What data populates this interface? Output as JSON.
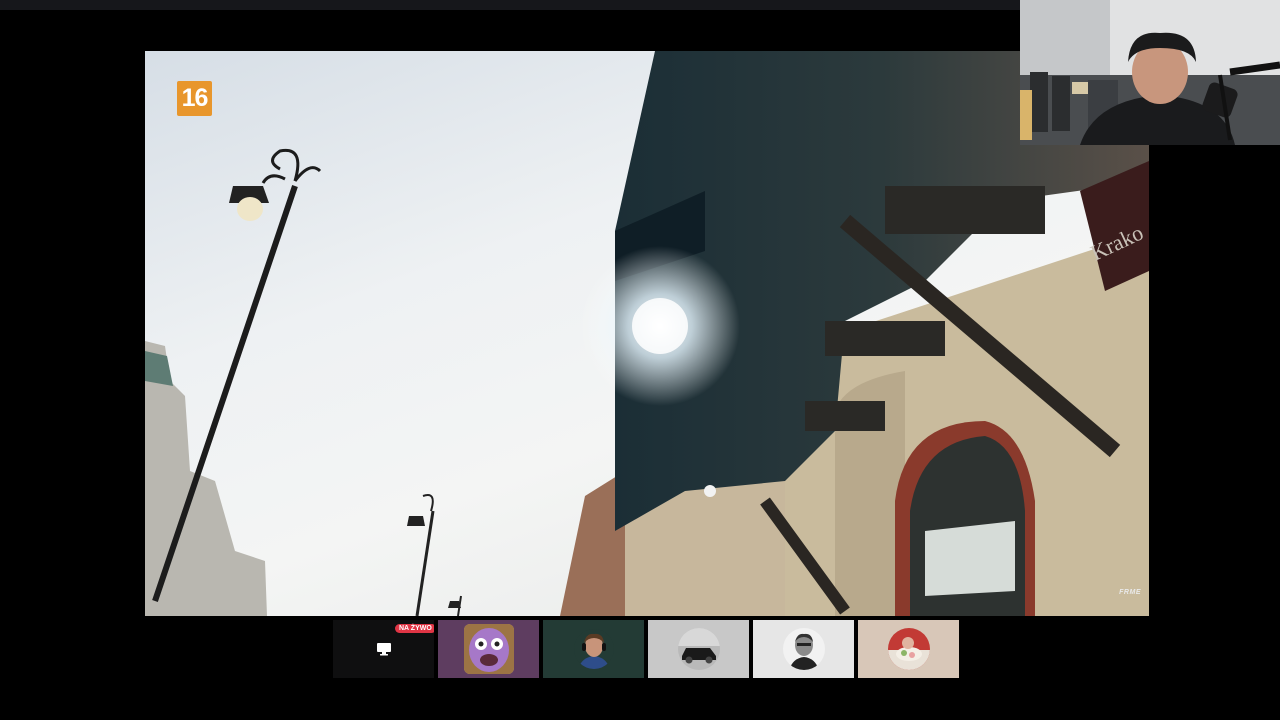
{
  "main_video": {
    "age_rating": "16",
    "watermark": "FRME"
  },
  "strip": {
    "live_label": "NA ŻYWO",
    "screen_icon": "monitor-icon",
    "participants": [
      {
        "avatar": "cartoon-face-avatar",
        "bg": "#5e3d60"
      },
      {
        "avatar": "man-with-headphones-avatar",
        "bg": "#233b35"
      },
      {
        "avatar": "car-avatar",
        "bg": "#c8c8c8"
      },
      {
        "avatar": "man-bw-photo-avatar",
        "bg": "#e6e6e6"
      },
      {
        "avatar": "food-avatar",
        "bg": "#d8c7b8"
      }
    ]
  }
}
